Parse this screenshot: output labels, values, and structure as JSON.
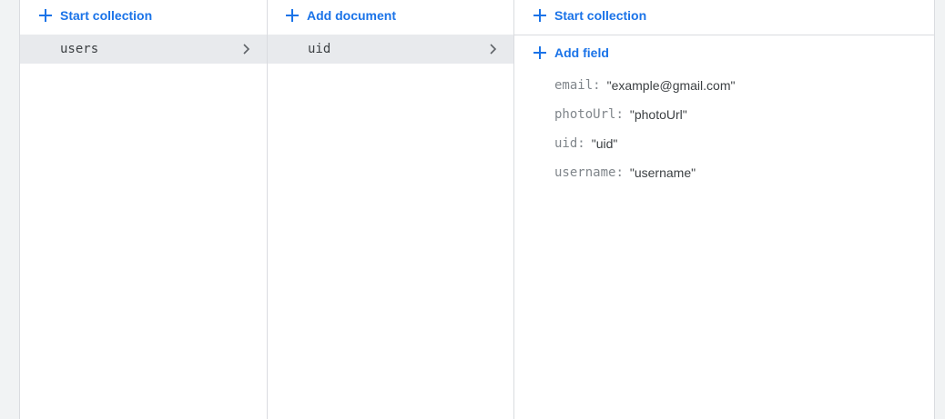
{
  "panels": {
    "collections": {
      "action_label": "Start collection",
      "items": [
        {
          "label": "users",
          "selected": true
        }
      ]
    },
    "documents": {
      "action_label": "Add document",
      "items": [
        {
          "label": "uid",
          "selected": true
        }
      ]
    },
    "document": {
      "collection_action_label": "Start collection",
      "field_action_label": "Add field",
      "fields": [
        {
          "key": "email",
          "value": "\"example@gmail.com\""
        },
        {
          "key": "photoUrl",
          "value": "\"photoUrl\""
        },
        {
          "key": "uid",
          "value": "\"uid\""
        },
        {
          "key": "username",
          "value": "\"username\""
        }
      ]
    }
  },
  "colors": {
    "accent": "#1a73e8",
    "selected_row": "#e8eaed",
    "divider": "#dadce0",
    "key_text": "#80868b",
    "value_text": "#3c4043"
  },
  "icons": {
    "add": "plus-icon",
    "open": "chevron-right-icon"
  }
}
